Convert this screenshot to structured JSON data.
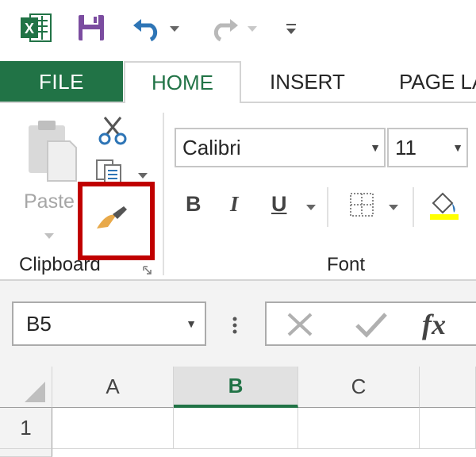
{
  "quick_access": {
    "app_icon": "excel-logo-icon",
    "save_icon": "save-icon",
    "undo_icon": "undo-icon",
    "redo_icon": "redo-icon",
    "customize_icon": "customize-toolbar-icon"
  },
  "tabs": [
    {
      "label": "FILE"
    },
    {
      "label": "HOME",
      "active": true
    },
    {
      "label": "INSERT"
    },
    {
      "label": "PAGE LA"
    }
  ],
  "ribbon": {
    "clipboard": {
      "group_label": "Clipboard",
      "paste_label": "Paste",
      "cut_icon": "scissors-icon",
      "copy_icon": "copy-icon",
      "format_painter_icon": "paintbrush-icon"
    },
    "font": {
      "group_label": "Font",
      "font_name": "Calibri",
      "font_size": "11",
      "bold": "B",
      "italic": "I",
      "underline": "U"
    }
  },
  "formula_bar": {
    "name_box": "B5",
    "fx_label": "fx",
    "cancel_icon": "cancel-x-icon",
    "enter_icon": "checkmark-icon"
  },
  "grid": {
    "columns": [
      "A",
      "B",
      "C"
    ],
    "selected_column": "B",
    "rows": [
      "1"
    ]
  },
  "colors": {
    "accent": "#217346",
    "highlight": "#c00000"
  }
}
